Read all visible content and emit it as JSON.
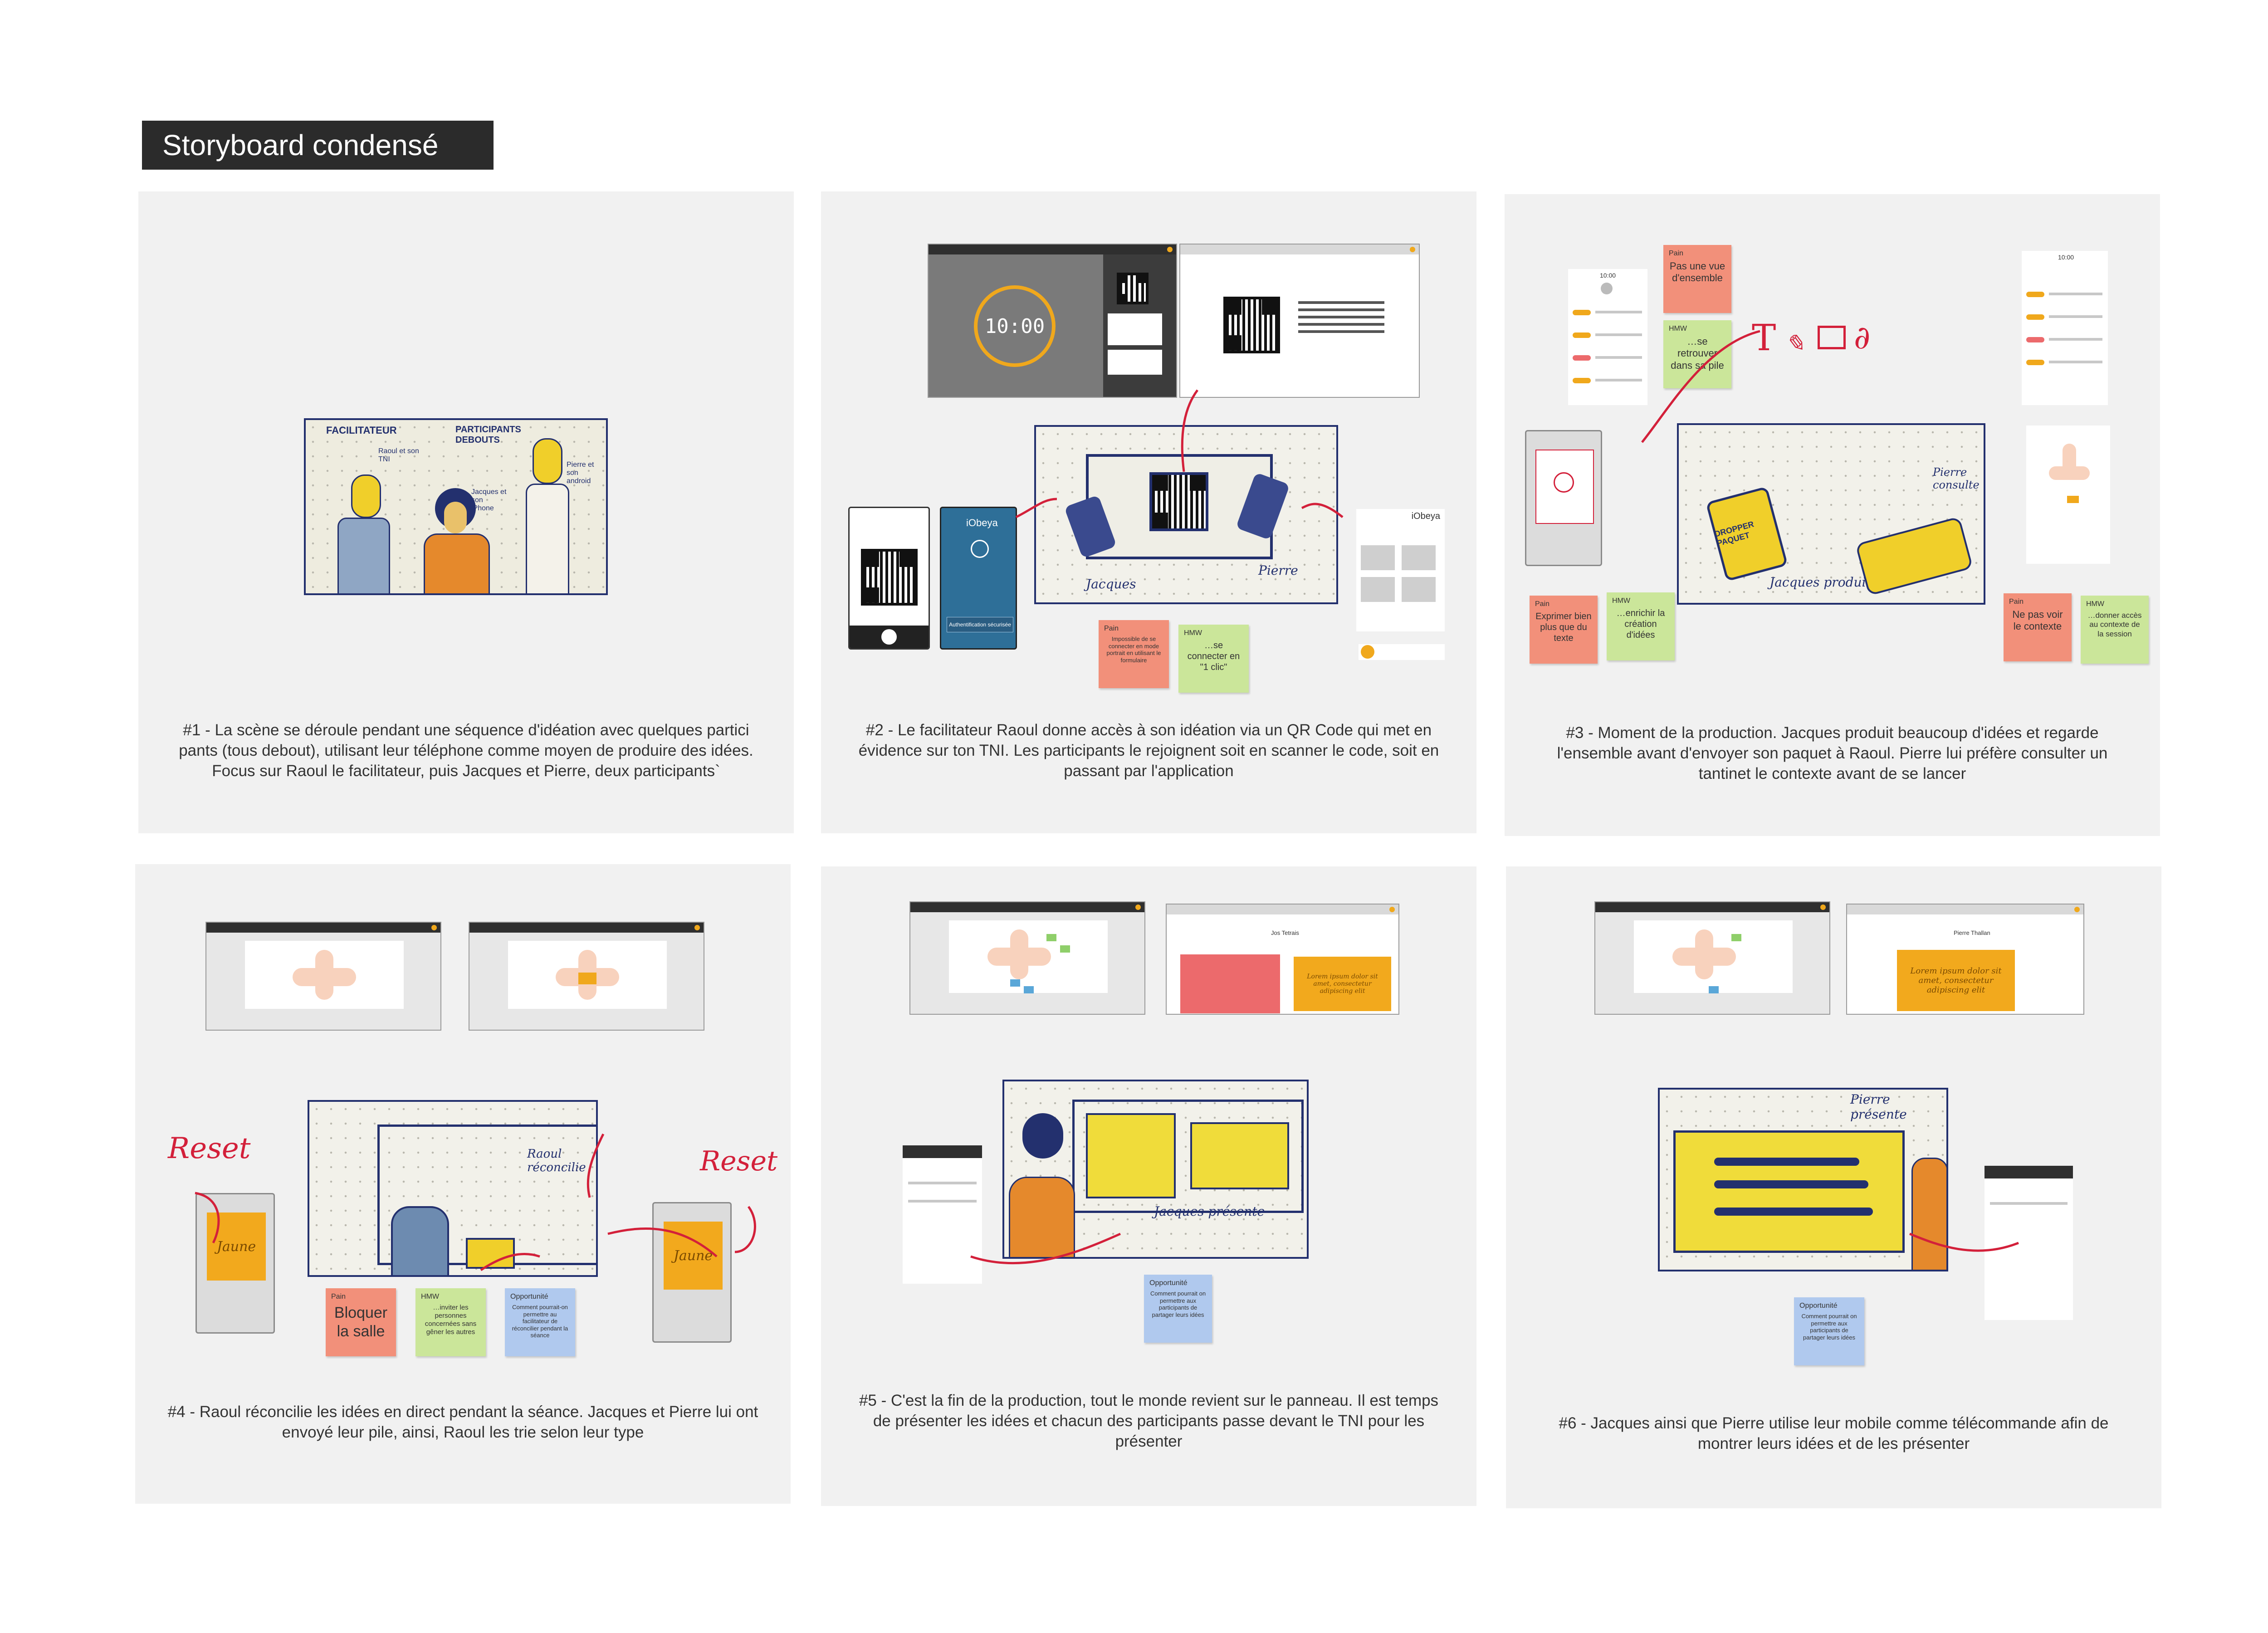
{
  "title": "Storyboard condensé",
  "panels": [
    {
      "caption": "#1 - La scène se déroule pendant une séquence d'idéation avec quelques partici pants (tous debout), utilisant leur téléphone comme moyen de produire des idées. Focus sur Raoul le facilitateur, puis Jacques et Pierre, deux participants`",
      "sketch_labels": [
        "FACILITATEUR",
        "Raoul et son TNI",
        "PARTICIPANTS DEBOUTS",
        "Jacques et son iPhone",
        "Pierre et son android"
      ]
    },
    {
      "caption": "#2 - Le facilitateur Raoul donne accès à son idéation via un QR Code qui met en évidence sur ton TNI. Les participants le rejoignent soit en scanner le code, soit en passant par l'application",
      "clock": "10:00",
      "app_name": "iObeya",
      "auth_button": "Authentification sécurisée",
      "sketch_labels": [
        "Jacques",
        "Pierre"
      ],
      "stickies": [
        {
          "type": "Pain",
          "text": "Impossible de se connecter en mode portrait en utilisant le formulaire"
        },
        {
          "type": "HMW",
          "text": "…se connecter en \"1 clic\""
        }
      ]
    },
    {
      "caption": "#3 - Moment de la production. Jacques produit beaucoup d'idées et regarde l'ensemble avant d'envoyer son paquet à Raoul. Pierre lui préfère consulter un tantinet le contexte avant de se lancer",
      "clock": "10:00",
      "sketch_labels": [
        "DROPPER PAQUET",
        "Jacques produit",
        "Pierre consulte"
      ],
      "stickies": [
        {
          "type": "Pain",
          "text": "Pas une vue d'ensemble"
        },
        {
          "type": "HMW",
          "text": "…se retrouver dans sa pile"
        },
        {
          "type": "Pain",
          "text": "Exprimer bien plus que du texte"
        },
        {
          "type": "HMW",
          "text": "…enrichir la création d'idées"
        },
        {
          "type": "Pain",
          "text": "Ne pas voir le contexte"
        },
        {
          "type": "HMW",
          "text": "…donner accès au contexte de la session"
        }
      ]
    },
    {
      "caption": "#4 - Raoul réconcilie les idées en direct pendant la séance. Jacques et Pierre lui ont envoyé leur pile, ainsi, Raoul les trie selon leur type",
      "hand_labels": [
        "Reset",
        "Reset"
      ],
      "sketch_labels": [
        "Raoul réconcilie"
      ],
      "note_text": "Jaune",
      "stickies": [
        {
          "type": "Pain",
          "text": "Bloquer la salle"
        },
        {
          "type": "HMW",
          "text": "…inviter les personnes concernées sans gêner les autres"
        },
        {
          "type": "Opportunité",
          "text": "Comment pourrait-on permettre au facilitateur de réconcilier pendant la séance"
        }
      ]
    },
    {
      "caption": "#5 - C'est la fin de la production, tout le monde revient sur le panneau. Il est temps de présenter les idées et chacun des participants passe devant le TNI pour les présenter",
      "user_name": "Jos Tetrais",
      "note_text": "Lorem ipsum dolor sit amet, consectetur adipiscing elit",
      "sketch_labels": [
        "Jacques présente"
      ],
      "stickies": [
        {
          "type": "Opportunité",
          "text": "Comment pourrait on permettre aux participants de partager leurs idées"
        }
      ]
    },
    {
      "caption": "#6 - Jacques ainsi que Pierre utilise leur mobile comme télécommande afin de montrer leurs idées et de les présenter",
      "user_name": "Pierre Thallan",
      "note_text": "Lorem ipsum dolor sit amet, consectetur adipiscing elit",
      "sketch_labels": [
        "Pierre présente"
      ],
      "stickies": [
        {
          "type": "Opportunité",
          "text": "Comment pourrait on permettre aux participants de partager leurs idées"
        }
      ]
    }
  ]
}
